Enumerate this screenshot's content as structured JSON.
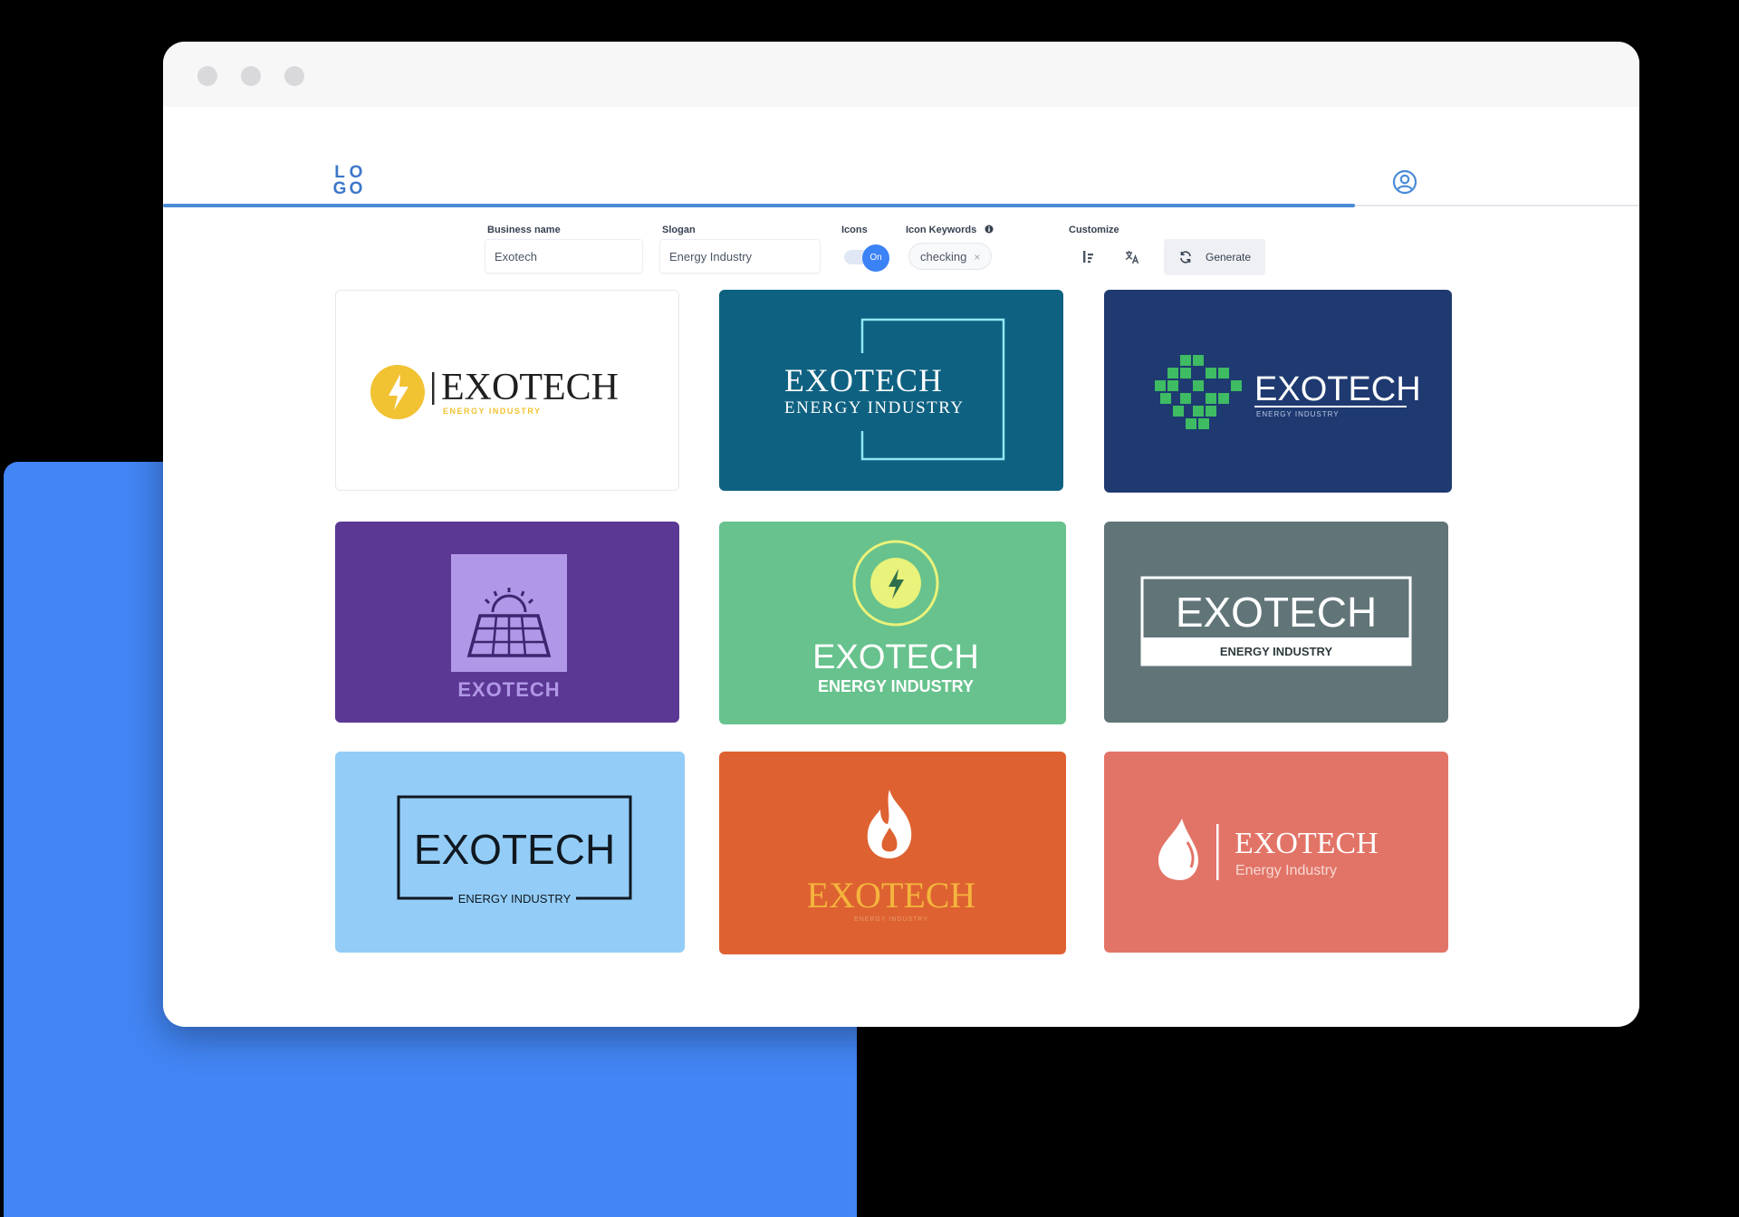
{
  "app": {
    "logo_text": [
      "L",
      "O",
      "G",
      "O"
    ]
  },
  "form": {
    "business_name": {
      "label": "Business name",
      "value": "Exotech"
    },
    "slogan": {
      "label": "Slogan",
      "value": "Energy Industry"
    },
    "icons": {
      "label": "Icons",
      "toggle_text": "On"
    },
    "icon_keywords": {
      "label": "Icon Keywords",
      "chip": "checking",
      "chip_remove": "×"
    },
    "customize": {
      "label": "Customize"
    },
    "generate_label": "Generate"
  },
  "logos": [
    {
      "name": "EXOTECH",
      "slogan": "ENERGY INDUSTRY",
      "bg": "#ffffff",
      "accent": "#f1c232"
    },
    {
      "name": "EXOTECH",
      "slogan": "ENERGY INDUSTRY",
      "bg": "#0e6181",
      "accent": "#8fe8f4"
    },
    {
      "name": "EXOTECH",
      "slogan": "ENERGY INDUSTRY",
      "bg": "#1e3a70",
      "accent": "#3ebb63"
    },
    {
      "name": "EXOTECH",
      "slogan": "",
      "bg": "#5b3893",
      "accent": "#b197e7"
    },
    {
      "name": "EXOTECH",
      "slogan": "ENERGY INDUSTRY",
      "bg": "#67c28d",
      "accent": "#e9f27a"
    },
    {
      "name": "EXOTECH",
      "slogan": "ENERGY INDUSTRY",
      "bg": "#617578",
      "accent": "#ffffff"
    },
    {
      "name": "EXOTECH",
      "slogan": "ENERGY INDUSTRY",
      "bg": "#93cdf7",
      "accent": "#101820"
    },
    {
      "name": "EXOTECH",
      "slogan": "ENERGY INDUSTRY",
      "bg": "#de6231",
      "accent": "#f4b53d"
    },
    {
      "name": "EXOTECH",
      "slogan": "Energy Industry",
      "bg": "#e27467",
      "accent": "#ffffff"
    }
  ],
  "colors": {
    "accent": "#3b82f6",
    "brand_blue": "#4285f4",
    "header_line": "#4a8bd8"
  }
}
